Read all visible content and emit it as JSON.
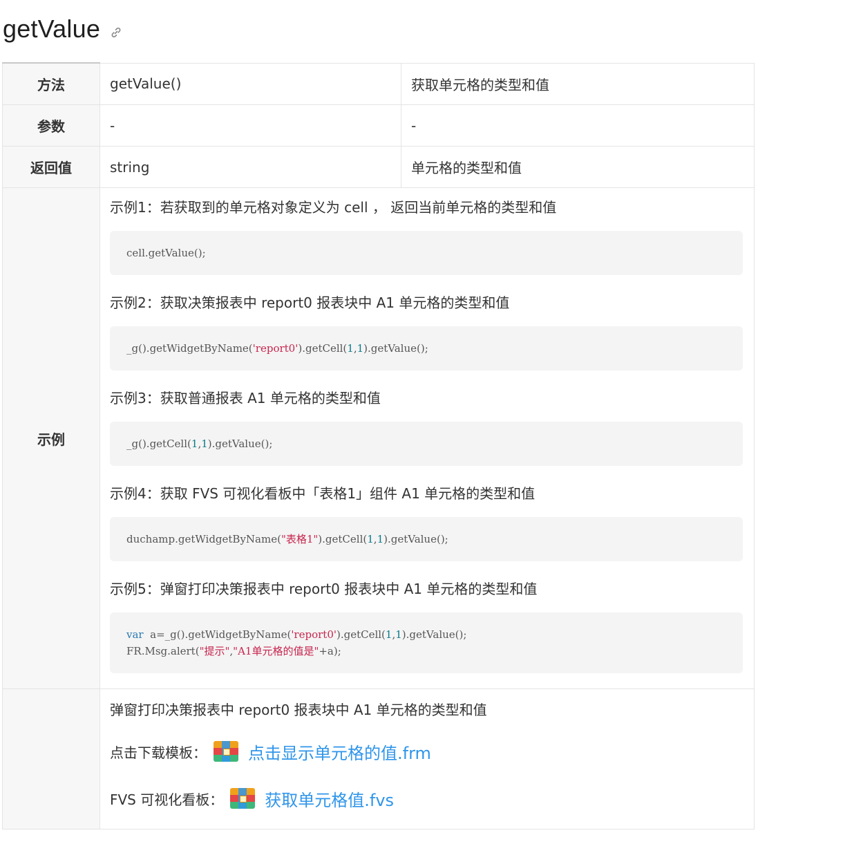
{
  "heading": {
    "title": "getValue",
    "anchor_icon": "link-icon"
  },
  "rows": {
    "method": {
      "key": "方法",
      "value": "getValue()",
      "desc": "获取单元格的类型和值"
    },
    "params": {
      "key": "参数",
      "value": "-",
      "desc": "-"
    },
    "return": {
      "key": "返回值",
      "value": "string",
      "desc": "单元格的类型和值"
    }
  },
  "examples": {
    "key": "示例",
    "ex1": {
      "desc": "示例1：若获取到的单元格对象定义为 cell ，  返回当前单元格的类型和值",
      "code": "cell.getValue();"
    },
    "ex2": {
      "desc": "示例2：获取决策报表中 report0 报表块中 A1 单元格的类型和值",
      "code": {
        "p1": "_g().getWidgetByName(",
        "s1": "'report0'",
        "p2": ").getCell(",
        "n1": "1",
        "p3": ",",
        "n2": "1",
        "p4": ").getValue();"
      }
    },
    "ex3": {
      "desc": "示例3：获取普通报表 A1 单元格的类型和值",
      "code": {
        "p1": "_g().getCell(",
        "n1": "1",
        "p2": ",",
        "n2": "1",
        "p3": ").getValue();"
      }
    },
    "ex4": {
      "desc": "示例4：获取 FVS 可视化看板中「表格1」组件 A1 单元格的类型和值",
      "code": {
        "p1": "duchamp.getWidgetByName(",
        "s1": "\"表格1\"",
        "p2": ").getCell(",
        "n1": "1",
        "p3": ",",
        "n2": "1",
        "p4": ").getValue();"
      }
    },
    "ex5": {
      "desc": "示例5：弹窗打印决策报表中 report0 报表块中 A1 单元格的类型和值",
      "code": {
        "kw": "var",
        "p1": "  a=_g().getWidgetByName(",
        "s1": "'report0'",
        "p2": ").getCell(",
        "n1": "1",
        "p3": ",",
        "n2": "1",
        "p4": ").getValue();",
        "l2p1": "FR.Msg.alert(",
        "l2s1": "\"提示\"",
        "l2p2": ",",
        "l2s2": "\"A1单元格的值是\"",
        "l2p3": "+a);"
      }
    }
  },
  "downloads": {
    "desc": "弹窗打印决策报表中 report0 报表块中 A1 单元格的类型和值",
    "template_label": "点击下载模板：",
    "template_link": "点击显示单元格的值.frm",
    "fvs_label": "FVS 可视化看板：",
    "fvs_link": "获取单元格值.fvs",
    "file_icon": "archive-file-icon"
  }
}
